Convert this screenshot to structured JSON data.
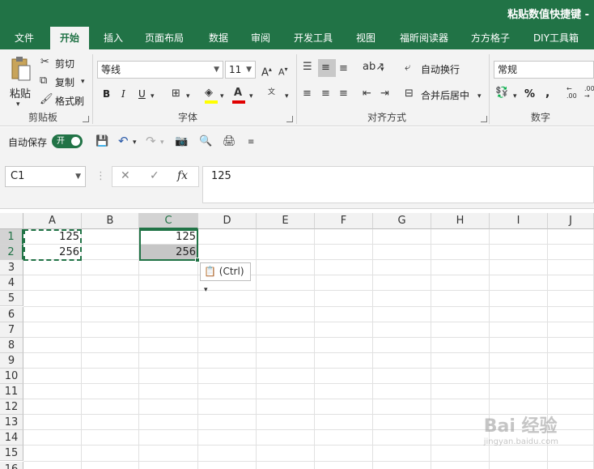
{
  "window": {
    "title": "粘贴数值快捷键 -"
  },
  "tabs": [
    {
      "label": "文件"
    },
    {
      "label": "开始"
    },
    {
      "label": "插入"
    },
    {
      "label": "页面布局"
    },
    {
      "label": "数据"
    },
    {
      "label": "审阅"
    },
    {
      "label": "开发工具"
    },
    {
      "label": "视图"
    },
    {
      "label": "福昕阅读器"
    },
    {
      "label": "方方格子"
    },
    {
      "label": "DIY工具箱"
    }
  ],
  "active_tab": "开始",
  "ribbon": {
    "clipboard": {
      "paste": "粘贴",
      "cut": "剪切",
      "copy": "复制",
      "format_painter": "格式刷",
      "group_label": "剪贴板"
    },
    "font": {
      "font_name": "等线",
      "font_size": "11",
      "bold": "B",
      "italic": "I",
      "underline": "U",
      "group_label": "字体"
    },
    "alignment": {
      "wrap_text": "自动换行",
      "merge_center": "合并后居中",
      "group_label": "对齐方式"
    },
    "number": {
      "format": "常规",
      "percent": "%",
      "comma": ",",
      "group_label": "数字"
    }
  },
  "qat": {
    "autosave_label": "自动保存",
    "autosave_state": "开"
  },
  "formula_bar": {
    "name_box": "C1",
    "formula": "125",
    "fx": "fx"
  },
  "columns": [
    "A",
    "B",
    "C",
    "D",
    "E",
    "F",
    "G",
    "H",
    "I",
    "J"
  ],
  "rows": [
    "1",
    "2",
    "3",
    "4",
    "5",
    "6",
    "7",
    "8",
    "9",
    "10",
    "11",
    "12",
    "13",
    "14",
    "15",
    "16"
  ],
  "cells": {
    "A1": "125",
    "A2": "256",
    "C1": "125",
    "C2": "256"
  },
  "paste_options": {
    "label": "(Ctrl)"
  },
  "watermark": {
    "text": "Bai 经验",
    "url": "jingyan.baidu.com"
  },
  "colors": {
    "accent": "#217346",
    "selection_fill": "#c6c6c6"
  }
}
